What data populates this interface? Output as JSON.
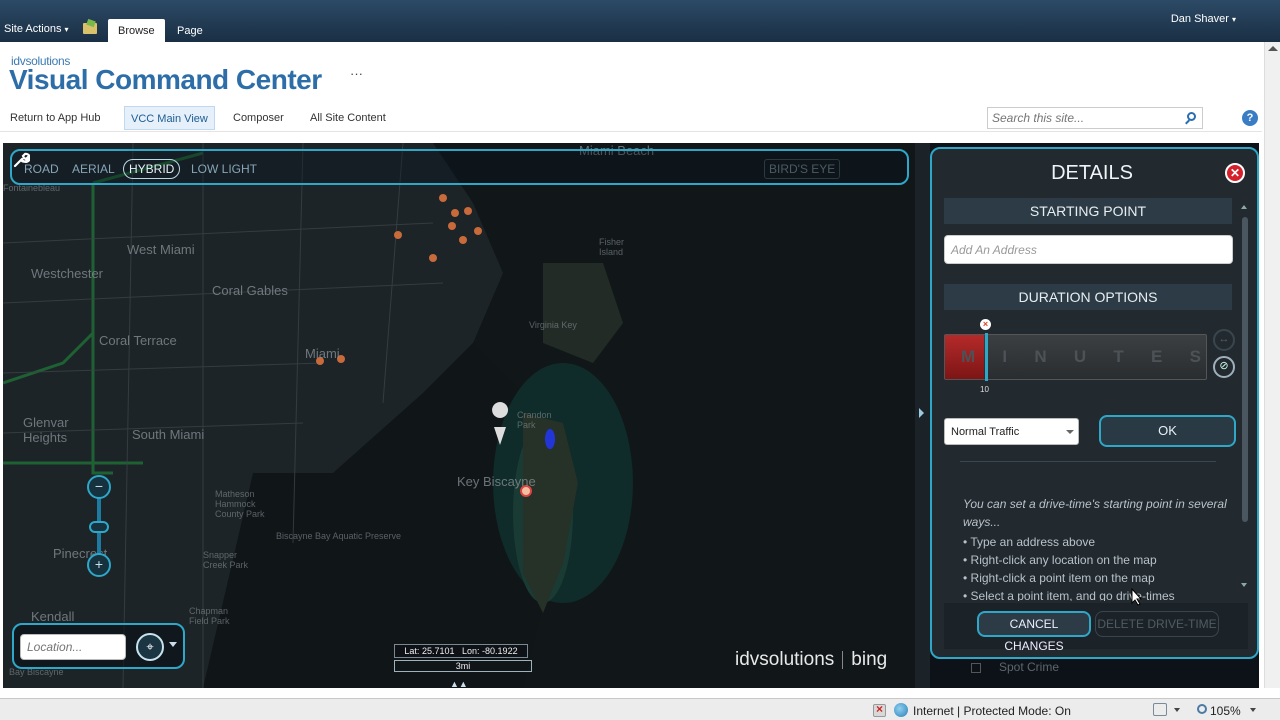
{
  "ribbon": {
    "site_actions": "Site Actions",
    "tabs": [
      {
        "label": "Browse",
        "active": true
      },
      {
        "label": "Page",
        "active": false
      }
    ],
    "user": "Dan Shaver"
  },
  "header": {
    "brand_small": "idvsolutions",
    "title": "Visual Command Center",
    "more": "···"
  },
  "nav": {
    "items": [
      {
        "label": "Return to App Hub",
        "active": false
      },
      {
        "label": "VCC Main View",
        "active": true
      },
      {
        "label": "Composer",
        "active": false
      },
      {
        "label": "All Site Content",
        "active": false
      }
    ],
    "search_placeholder": "Search this site...",
    "help": "?"
  },
  "map": {
    "modes": [
      {
        "label": "ROAD",
        "active": false
      },
      {
        "label": "AERIAL",
        "active": false
      },
      {
        "label": "HYBRID",
        "active": true
      },
      {
        "label": "LOW LIGHT",
        "active": false
      }
    ],
    "birds_eye": "BIRD'S EYE",
    "labels": [
      "Miami Beach",
      "West Miami",
      "Westchester",
      "Coral Gables",
      "Coral Terrace",
      "Miami",
      "South Miami",
      "Glenvar Heights",
      "Key Biscayne",
      "Crandon Park",
      "Biscayne Bay Aquatic Preserve",
      "Pinecrest",
      "Kendall",
      "Fisher Island",
      "Virginia Key",
      "Matheson Hammock County Park",
      "Snapper Creek Park",
      "Chapman Field Park",
      "Bay Biscayne",
      "Fontainebleau"
    ],
    "location_placeholder": "Location...",
    "lat_label": "Lat:",
    "lat": "25.7101",
    "lon_label": "Lon:",
    "lon": "-80.1922",
    "scale": "3mi",
    "logo_idv": "idvsolutions",
    "logo_bing": "bing",
    "zoom_out": "−",
    "zoom_in": "+"
  },
  "details": {
    "title": "DETAILS",
    "starting_point": "STARTING POINT",
    "address_placeholder": "Add An Address",
    "duration_options": "DURATION OPTIONS",
    "slider_letters": [
      "M",
      "I",
      "N",
      "U",
      "T",
      "E",
      "S"
    ],
    "slider_value": 10,
    "slider_fraction": 0.15,
    "traffic_option": "Normal Traffic",
    "ok": "OK",
    "help_intro": "You can set a drive-time's starting point in several ways...",
    "help_items": [
      "Type an address above",
      "Right-click any location on the map",
      "Right-click a point item on the map",
      "Select a point item, and go drive-times"
    ],
    "cancel": "CANCEL CHANGES",
    "delete": "DELETE DRIVE-TIME",
    "below_item": "Spot Crime"
  },
  "status": {
    "zone": "Internet | Protected Mode: On",
    "zoom": "105%"
  },
  "colors": {
    "accent": "#2ea7c8",
    "ribbon": "#21384f",
    "brand": "#2d6ea8",
    "danger": "#d4212c"
  }
}
